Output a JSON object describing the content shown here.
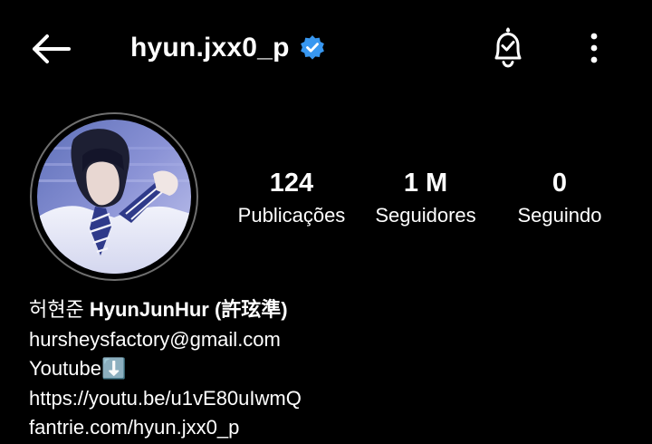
{
  "header": {
    "username": "hyun.jxx0_p",
    "verified": true,
    "back_icon": "arrow-left-icon",
    "bell_icon": "bell-check-icon",
    "more_icon": "vertical-ellipsis-icon"
  },
  "stats": {
    "posts": {
      "value": "124",
      "label": "Publicações"
    },
    "followers": {
      "value": "1 M",
      "label": "Seguidores"
    },
    "following": {
      "value": "0",
      "label": "Seguindo"
    }
  },
  "bio": {
    "name_korean": "허현준",
    "name_rest": "HyunJunHur (許玹準)",
    "email": "hursheysfactory@gmail.com",
    "youtube": "Youtube⬇️",
    "youtube_link": "https://youtu.be/u1vE80uIwmQ",
    "fantrie_link": "fantrie.com/hyun.jxx0_p"
  },
  "colors": {
    "background": "#000000",
    "text": "#ffffff",
    "verified_badge": "#3897f0",
    "avatar_ring": "#6f6f6f"
  }
}
